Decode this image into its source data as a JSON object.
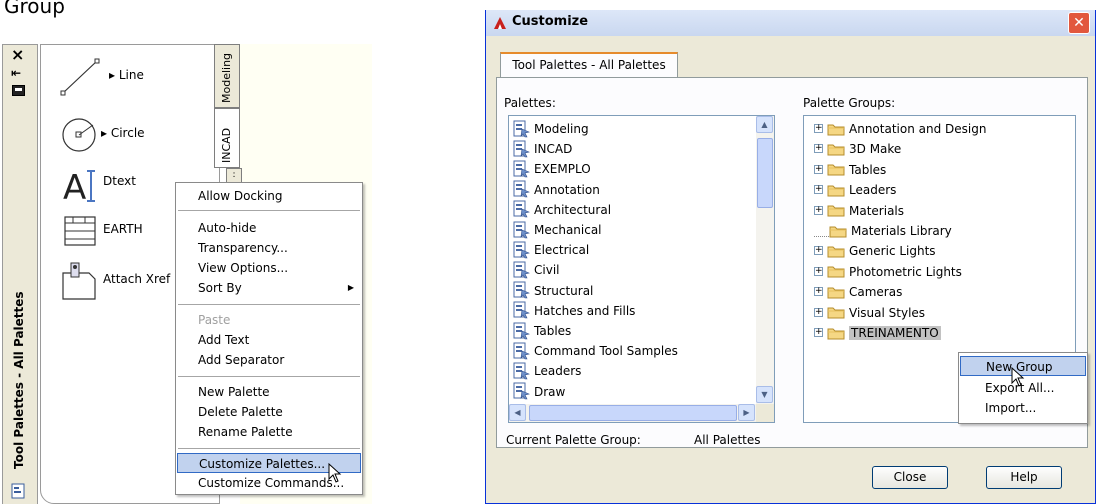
{
  "page": {
    "header_fragment": "Group"
  },
  "tool_palette": {
    "title": "Tool Palettes - All Palettes",
    "tabs": [
      "Modeling",
      "INCAD"
    ],
    "tools": [
      {
        "label": "Line",
        "icon": "line-tool-icon",
        "has_flyout": true
      },
      {
        "label": "Circle",
        "icon": "circle-tool-icon",
        "has_flyout": true
      },
      {
        "label": "Dtext",
        "icon": "text-tool-icon",
        "has_flyout": false
      },
      {
        "label": "EARTH",
        "icon": "hatch-tool-icon",
        "has_flyout": false
      },
      {
        "label": "Attach Xref",
        "icon": "xref-tool-icon",
        "has_flyout": false
      }
    ]
  },
  "context_menu": {
    "items": [
      {
        "label": "Allow Docking",
        "state": "normal"
      },
      {
        "label": "Auto-hide",
        "state": "normal"
      },
      {
        "label": "Transparency...",
        "state": "normal"
      },
      {
        "label": "View Options...",
        "state": "normal"
      },
      {
        "label": "Sort By",
        "state": "normal",
        "submenu": true
      },
      {
        "label": "Paste",
        "state": "disabled"
      },
      {
        "label": "Add Text",
        "state": "normal"
      },
      {
        "label": "Add Separator",
        "state": "normal"
      },
      {
        "label": "New Palette",
        "state": "normal"
      },
      {
        "label": "Delete Palette",
        "state": "normal"
      },
      {
        "label": "Rename Palette",
        "state": "normal"
      },
      {
        "label": "Customize Palettes...",
        "state": "highlighted"
      },
      {
        "label": "Customize Commands...",
        "state": "normal"
      }
    ]
  },
  "dialog": {
    "title": "Customize",
    "tab_label": "Tool Palettes - All Palettes",
    "palettes_label": "Palettes:",
    "palette_groups_label": "Palette Groups:",
    "palettes": [
      "Modeling",
      "INCAD",
      "EXEMPLO",
      "Annotation",
      "Architectural",
      "Mechanical",
      "Electrical",
      "Civil",
      "Structural",
      "Hatches and Fills",
      "Tables",
      "Command Tool Samples",
      "Leaders",
      "Draw"
    ],
    "palette_groups": [
      {
        "label": "Annotation and Design",
        "expandable": true
      },
      {
        "label": "3D Make",
        "expandable": true
      },
      {
        "label": "Tables",
        "expandable": true
      },
      {
        "label": "Leaders",
        "expandable": true
      },
      {
        "label": "Materials",
        "expandable": true
      },
      {
        "label": "Materials Library",
        "expandable": false
      },
      {
        "label": "Generic Lights",
        "expandable": true
      },
      {
        "label": "Photometric Lights",
        "expandable": true
      },
      {
        "label": "Cameras",
        "expandable": true
      },
      {
        "label": "Visual Styles",
        "expandable": true
      },
      {
        "label": "TREINAMENTO",
        "expandable": true,
        "selected": true
      }
    ],
    "current_group_label": "Current Palette Group:",
    "current_group_value": "All Palettes",
    "close_label": "Close",
    "help_label": "Help",
    "group_context_menu": [
      "New Group",
      "Export All...",
      "Import..."
    ]
  },
  "colors": {
    "selection": "#c2c2c2",
    "menu_highlight": "#c1d2ee",
    "dialog_bg": "#ece9d8",
    "accent_tab": "#e68b2c",
    "close_button": "#e2583e"
  }
}
